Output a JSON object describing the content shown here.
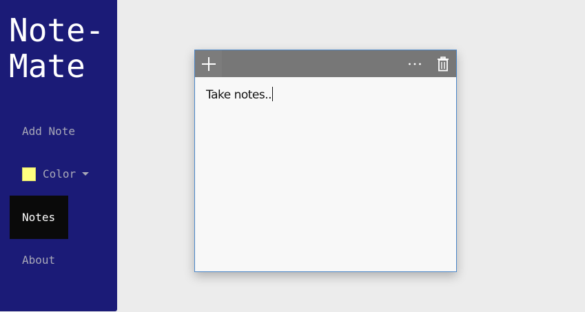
{
  "app": {
    "title_line1": "Note-",
    "title_line2": "Mate"
  },
  "sidebar": {
    "items": [
      {
        "label": "Add Note"
      },
      {
        "label": "Color",
        "swatch_color": "#ffff80"
      },
      {
        "label": "Notes",
        "active": true
      },
      {
        "label": "About"
      }
    ]
  },
  "note": {
    "text": "Take notes.."
  },
  "icons": {
    "add": "plus-icon",
    "more": "more-dots-icon",
    "delete": "trash-icon",
    "dropdown": "chevron-down-icon"
  },
  "colors": {
    "sidebar_bg": "#1b1b77",
    "active_item_bg": "#0a0a0a",
    "toolbar_bg": "#777777",
    "note_bg": "#f8f8f8",
    "note_border": "#4a86c8"
  }
}
